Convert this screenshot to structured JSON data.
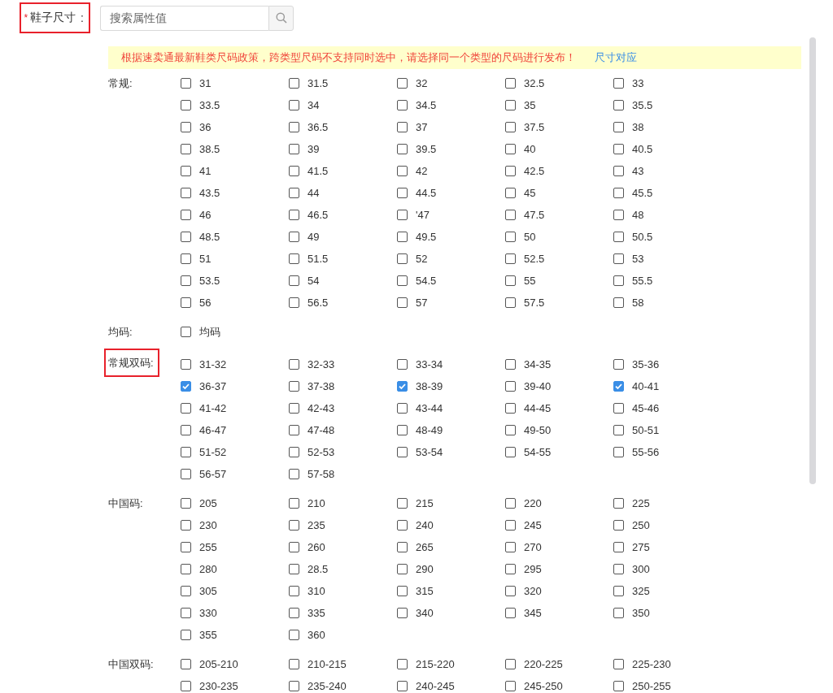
{
  "field": {
    "required_mark": "*",
    "label": "鞋子尺寸",
    "colon": ":",
    "highlighted": true
  },
  "search": {
    "placeholder": "搜索属性值"
  },
  "notice": {
    "text": "根据速卖通最新鞋类尺码政策，跨类型尺码不支持同时选中，请选择同一个类型的尺码进行发布！",
    "link": "尺寸对应"
  },
  "groups": [
    {
      "label": "常规:",
      "highlighted": false,
      "options": [
        {
          "label": "31",
          "checked": false
        },
        {
          "label": "31.5",
          "checked": false
        },
        {
          "label": "32",
          "checked": false
        },
        {
          "label": "32.5",
          "checked": false
        },
        {
          "label": "33",
          "checked": false
        },
        {
          "label": "33.5",
          "checked": false
        },
        {
          "label": "34",
          "checked": false
        },
        {
          "label": "34.5",
          "checked": false
        },
        {
          "label": "35",
          "checked": false
        },
        {
          "label": "35.5",
          "checked": false
        },
        {
          "label": "36",
          "checked": false
        },
        {
          "label": "36.5",
          "checked": false
        },
        {
          "label": "37",
          "checked": false
        },
        {
          "label": "37.5",
          "checked": false
        },
        {
          "label": "38",
          "checked": false
        },
        {
          "label": "38.5",
          "checked": false
        },
        {
          "label": "39",
          "checked": false
        },
        {
          "label": "39.5",
          "checked": false
        },
        {
          "label": "40",
          "checked": false
        },
        {
          "label": "40.5",
          "checked": false
        },
        {
          "label": "41",
          "checked": false
        },
        {
          "label": "41.5",
          "checked": false
        },
        {
          "label": "42",
          "checked": false
        },
        {
          "label": "42.5",
          "checked": false
        },
        {
          "label": "43",
          "checked": false
        },
        {
          "label": "43.5",
          "checked": false
        },
        {
          "label": "44",
          "checked": false
        },
        {
          "label": "44.5",
          "checked": false
        },
        {
          "label": "45",
          "checked": false
        },
        {
          "label": "45.5",
          "checked": false
        },
        {
          "label": "46",
          "checked": false
        },
        {
          "label": "46.5",
          "checked": false
        },
        {
          "label": "'47",
          "checked": false
        },
        {
          "label": "47.5",
          "checked": false
        },
        {
          "label": "48",
          "checked": false
        },
        {
          "label": "48.5",
          "checked": false
        },
        {
          "label": "49",
          "checked": false
        },
        {
          "label": "49.5",
          "checked": false
        },
        {
          "label": "50",
          "checked": false
        },
        {
          "label": "50.5",
          "checked": false
        },
        {
          "label": "51",
          "checked": false
        },
        {
          "label": "51.5",
          "checked": false
        },
        {
          "label": "52",
          "checked": false
        },
        {
          "label": "52.5",
          "checked": false
        },
        {
          "label": "53",
          "checked": false
        },
        {
          "label": "53.5",
          "checked": false
        },
        {
          "label": "54",
          "checked": false
        },
        {
          "label": "54.5",
          "checked": false
        },
        {
          "label": "55",
          "checked": false
        },
        {
          "label": "55.5",
          "checked": false
        },
        {
          "label": "56",
          "checked": false
        },
        {
          "label": "56.5",
          "checked": false
        },
        {
          "label": "57",
          "checked": false
        },
        {
          "label": "57.5",
          "checked": false
        },
        {
          "label": "58",
          "checked": false
        }
      ]
    },
    {
      "label": "均码:",
      "highlighted": false,
      "options": [
        {
          "label": "均码",
          "checked": false
        }
      ]
    },
    {
      "label": "常规双码:",
      "highlighted": true,
      "options": [
        {
          "label": "31-32",
          "checked": false
        },
        {
          "label": "32-33",
          "checked": false
        },
        {
          "label": "33-34",
          "checked": false
        },
        {
          "label": "34-35",
          "checked": false
        },
        {
          "label": "35-36",
          "checked": false
        },
        {
          "label": "36-37",
          "checked": true
        },
        {
          "label": "37-38",
          "checked": false
        },
        {
          "label": "38-39",
          "checked": true
        },
        {
          "label": "39-40",
          "checked": false
        },
        {
          "label": "40-41",
          "checked": true
        },
        {
          "label": "41-42",
          "checked": false
        },
        {
          "label": "42-43",
          "checked": false
        },
        {
          "label": "43-44",
          "checked": false
        },
        {
          "label": "44-45",
          "checked": false
        },
        {
          "label": "45-46",
          "checked": false
        },
        {
          "label": "46-47",
          "checked": false
        },
        {
          "label": "47-48",
          "checked": false
        },
        {
          "label": "48-49",
          "checked": false
        },
        {
          "label": "49-50",
          "checked": false
        },
        {
          "label": "50-51",
          "checked": false
        },
        {
          "label": "51-52",
          "checked": false
        },
        {
          "label": "52-53",
          "checked": false
        },
        {
          "label": "53-54",
          "checked": false
        },
        {
          "label": "54-55",
          "checked": false
        },
        {
          "label": "55-56",
          "checked": false
        },
        {
          "label": "56-57",
          "checked": false
        },
        {
          "label": "57-58",
          "checked": false
        }
      ]
    },
    {
      "label": "中国码:",
      "highlighted": false,
      "options": [
        {
          "label": "205",
          "checked": false
        },
        {
          "label": "210",
          "checked": false
        },
        {
          "label": "215",
          "checked": false
        },
        {
          "label": "220",
          "checked": false
        },
        {
          "label": "225",
          "checked": false
        },
        {
          "label": "230",
          "checked": false
        },
        {
          "label": "235",
          "checked": false
        },
        {
          "label": "240",
          "checked": false
        },
        {
          "label": "245",
          "checked": false
        },
        {
          "label": "250",
          "checked": false
        },
        {
          "label": "255",
          "checked": false
        },
        {
          "label": "260",
          "checked": false
        },
        {
          "label": "265",
          "checked": false
        },
        {
          "label": "270",
          "checked": false
        },
        {
          "label": "275",
          "checked": false
        },
        {
          "label": "280",
          "checked": false
        },
        {
          "label": "28.5",
          "checked": false
        },
        {
          "label": "290",
          "checked": false
        },
        {
          "label": "295",
          "checked": false
        },
        {
          "label": "300",
          "checked": false
        },
        {
          "label": "305",
          "checked": false
        },
        {
          "label": "310",
          "checked": false
        },
        {
          "label": "315",
          "checked": false
        },
        {
          "label": "320",
          "checked": false
        },
        {
          "label": "325",
          "checked": false
        },
        {
          "label": "330",
          "checked": false
        },
        {
          "label": "335",
          "checked": false
        },
        {
          "label": "340",
          "checked": false
        },
        {
          "label": "345",
          "checked": false
        },
        {
          "label": "350",
          "checked": false
        },
        {
          "label": "355",
          "checked": false
        },
        {
          "label": "360",
          "checked": false
        }
      ]
    },
    {
      "label": "中国双码:",
      "highlighted": false,
      "options": [
        {
          "label": "205-210",
          "checked": false
        },
        {
          "label": "210-215",
          "checked": false
        },
        {
          "label": "215-220",
          "checked": false
        },
        {
          "label": "220-225",
          "checked": false
        },
        {
          "label": "225-230",
          "checked": false
        },
        {
          "label": "230-235",
          "checked": false
        },
        {
          "label": "235-240",
          "checked": false
        },
        {
          "label": "240-245",
          "checked": false
        },
        {
          "label": "245-250",
          "checked": false
        },
        {
          "label": "250-255",
          "checked": false
        }
      ]
    }
  ]
}
